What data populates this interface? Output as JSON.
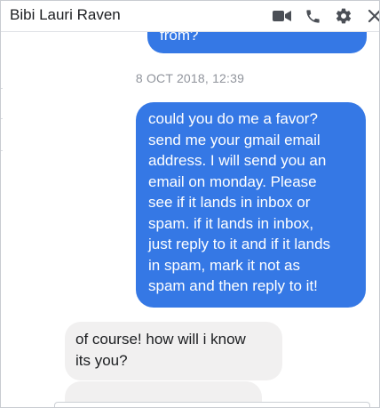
{
  "header": {
    "contact_name": "Bibi Lauri Raven",
    "icons": [
      "video-call-icon",
      "phone-call-icon",
      "settings-gear-icon",
      "close-icon"
    ]
  },
  "thread": {
    "previous_bubble_text": "from?",
    "timestamp": "8 OCT 2018, 12:39",
    "messages": [
      {
        "direction": "outgoing",
        "lines": [
          "could you do me a favor?",
          "send me your gmail email",
          "address. I will send you an",
          "email on monday. Please",
          "see if it lands in inbox or",
          "spam. if it lands in inbox,",
          "just reply to it and if it lands",
          "in spam, mark it not as",
          "spam and then reply to it!"
        ]
      },
      {
        "direction": "incoming",
        "lines": [
          "of course! how will i know",
          "its you?"
        ]
      }
    ]
  },
  "colors": {
    "outgoing_bubble": "#3578e5",
    "incoming_bubble": "#f1f0f0",
    "timestamp_text": "#90949c",
    "header_icons": "#4b4f56"
  }
}
